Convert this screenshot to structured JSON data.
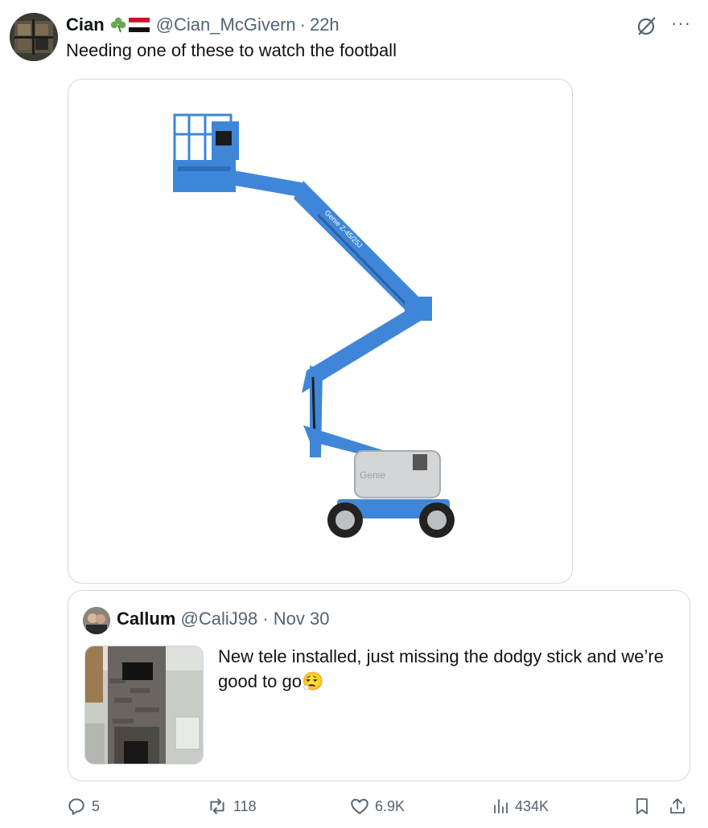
{
  "tweet": {
    "author_name": "Cian",
    "handle": "@Cian_McGivern",
    "separator": "·",
    "time": "22h",
    "text": "Needing one of these to watch the football",
    "media": {
      "icon": "boom-lift-image",
      "brand_text": "Genie Z-45/25J",
      "base_brand": "Genie"
    }
  },
  "quote": {
    "author_name": "Callum",
    "handle": "@CaliJ98",
    "separator": "·",
    "date": "Nov 30",
    "text": "New tele installed, just missing the dodgy stick and we’re good to go",
    "emoji": "😮‍💨"
  },
  "actions": {
    "replies": "5",
    "retweets": "118",
    "likes": "6.9K",
    "views": "434K"
  },
  "colors": {
    "text": "#0f1419",
    "muted": "#536471",
    "border": "#cfd9de",
    "lift_blue": "#3f86d8"
  }
}
